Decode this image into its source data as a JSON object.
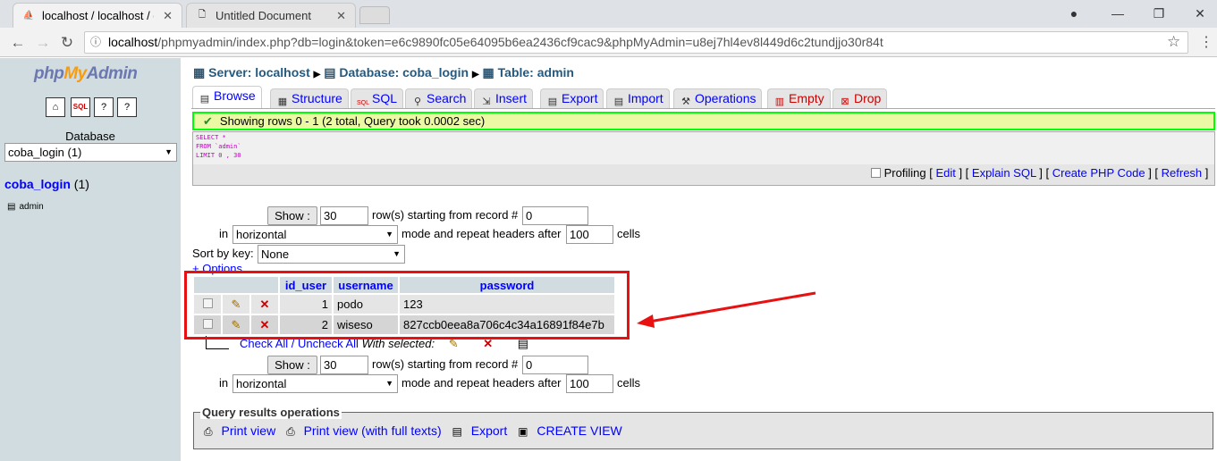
{
  "browser": {
    "tabs": [
      {
        "title": "localhost / localhost / co",
        "favicon": "pma-icon"
      },
      {
        "title": "Untitled Document",
        "favicon": "document-icon"
      }
    ],
    "url_host": "localhost",
    "url_rest": "/phpmyadmin/index.php?db=login&token=e6c9890fc05e64095b6ea2436cf9cac9&phpMyAdmin=u8ej7hl4ev8l449d6c2tundjjo30r84t"
  },
  "sidebar": {
    "logo_php": "php",
    "logo_my": "My",
    "logo_admin": "Admin",
    "database_label": "Database",
    "database_select": "coba_login (1)",
    "db_link": "coba_login",
    "db_count": "(1)",
    "table_item": "admin"
  },
  "breadcrumb": {
    "server": "Server: localhost",
    "database": "Database: coba_login",
    "table": "Table: admin"
  },
  "tabs": [
    "Browse",
    "Structure",
    "SQL",
    "Search",
    "Insert",
    "Export",
    "Import",
    "Operations",
    "Empty",
    "Drop"
  ],
  "status": {
    "message": "Showing rows 0 - 1 (2 total, Query took 0.0002 sec)"
  },
  "sql": {
    "line1": "SELECT *",
    "line2": "FROM `admin`",
    "line3": "LIMIT 0 , 30"
  },
  "sql_links": {
    "profiling": "Profiling",
    "edit": "Edit",
    "explain": "Explain SQL",
    "create_php": "Create PHP Code",
    "refresh": "Refresh"
  },
  "nav_form": {
    "show_label": "Show :",
    "rows_value": "30",
    "rows_text": "row(s) starting from record #",
    "start_value": "0",
    "in_text": "in",
    "mode_value": "horizontal",
    "mode_text": "mode and repeat headers after",
    "repeat_value": "100",
    "cells_text": "cells"
  },
  "sort": {
    "label": "Sort by key:",
    "value": "None",
    "options_link": "+ Options"
  },
  "results": {
    "columns": [
      "id_user",
      "username",
      "password"
    ],
    "rows": [
      {
        "id_user": "1",
        "username": "podo",
        "password": "123"
      },
      {
        "id_user": "2",
        "username": "wiseso",
        "password": "827ccb0eea8a706c4c34a16891f84e7b"
      }
    ]
  },
  "bulk": {
    "check_all": "Check All / Uncheck All",
    "with_selected": "With selected:"
  },
  "query_ops": {
    "legend": "Query results operations",
    "print_view": "Print view",
    "print_full": "Print view (with full texts)",
    "export": "Export",
    "create_view": "CREATE VIEW"
  },
  "colors": {
    "annotation_red": "#e81010",
    "status_green": "#00ff00",
    "link_blue": "#0000ff"
  }
}
